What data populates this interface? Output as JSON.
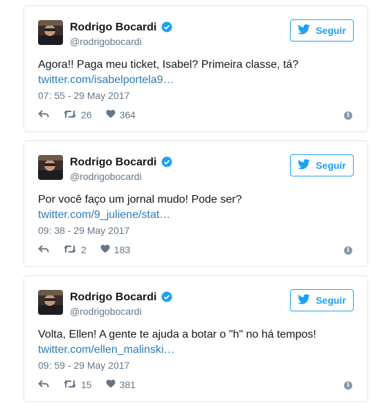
{
  "colors": {
    "accent": "#1da1f2",
    "link": "#2b7bb9",
    "muted": "#657786",
    "border": "#e1e8ed"
  },
  "follow_icon": "twitter-bird-icon",
  "tweets": [
    {
      "author": "Rodrigo Bocardi",
      "handle": "@rodrigobocardi",
      "follow_label": "Seguir",
      "text": "Agora!! Paga meu ticket, Isabel? Primeira classe, tá?",
      "link": "twitter.com/isabelportela9…",
      "timestamp": "07: 55 - 29 May 2017",
      "retweets": "26",
      "likes": "364"
    },
    {
      "author": "Rodrigo Bocardi",
      "handle": "@rodrigobocardi",
      "follow_label": "Seguir",
      "text": "Por você faço um jornal mudo! Pode ser?",
      "link": "twitter.com/9_juliene/stat…",
      "timestamp": "09: 38 - 29 May 2017",
      "retweets": "2",
      "likes": "183"
    },
    {
      "author": "Rodrigo Bocardi",
      "handle": "@rodrigobocardi",
      "follow_label": "Seguir",
      "text": "Volta, Ellen! A gente te ajuda a botar o \"h\" no há tempos!",
      "link": "twitter.com/ellen_malinski…",
      "timestamp": "09: 59 - 29 May 2017",
      "retweets": "15",
      "likes": "381"
    }
  ]
}
